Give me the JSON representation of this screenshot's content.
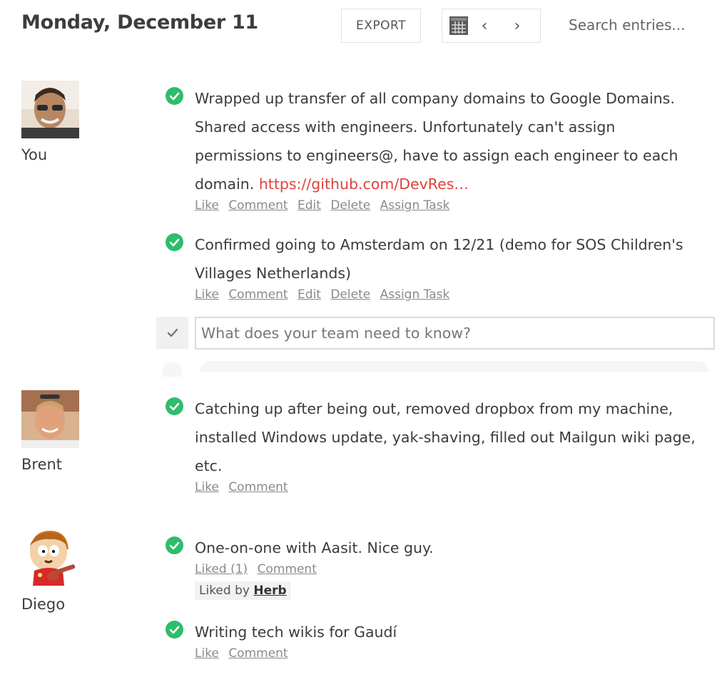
{
  "header": {
    "date": "Monday, December 11",
    "export_label": "EXPORT",
    "search_placeholder": "Search entries...",
    "prev_glyph": "‹",
    "next_glyph": "›"
  },
  "users": [
    {
      "name": "You",
      "entries": [
        {
          "text": "Wrapped up transfer of all company domains to Google Domains. Shared access with engineers. Unfortunately can't assign permissions to engineers@, have to assign each engineer to each domain. ",
          "link": "https://github.com/DevRes…",
          "actions": [
            "Like",
            "Comment",
            "Edit",
            "Delete",
            "Assign Task"
          ]
        },
        {
          "text": "Confirmed going to Amsterdam on 12/21 (demo for SOS Children's Villages Netherlands)",
          "actions": [
            "Like",
            "Comment",
            "Edit",
            "Delete",
            "Assign Task"
          ]
        }
      ]
    },
    {
      "name": "Brent",
      "entries": [
        {
          "text": "Catching up after being out, removed dropbox from my machine, installed Windows update, yak-shaving, filled out Mailgun wiki page, etc.",
          "actions": [
            "Like",
            "Comment"
          ]
        }
      ]
    },
    {
      "name": "Diego",
      "entries": [
        {
          "text": "One-on-one with Aasit. Nice guy.",
          "actions": [
            "Liked (1)",
            "Comment"
          ],
          "liked_by_label": "Liked by",
          "liked_by_name": "Herb"
        },
        {
          "text": "Writing tech wikis for Gaudí",
          "actions": [
            "Like",
            "Comment"
          ]
        }
      ]
    }
  ],
  "compose": {
    "placeholder": "What does your team need to know?"
  },
  "colors": {
    "check_green": "#2ebd6b",
    "link_red": "#e0413a",
    "action_gray": "#8a8a8a"
  },
  "icons": [
    "calendar-icon",
    "chevron-left-icon",
    "chevron-right-icon",
    "check-circle-icon",
    "checkmark-icon"
  ]
}
